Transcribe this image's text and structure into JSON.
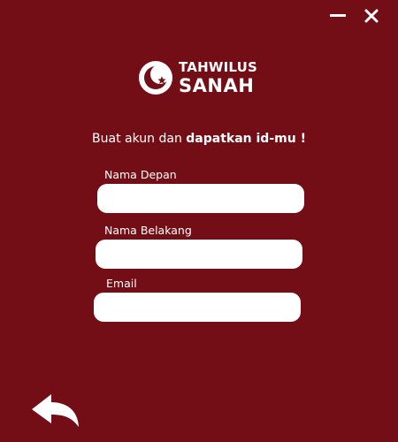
{
  "window": {
    "minimize_icon": "minimize-icon",
    "close_icon": "close-icon"
  },
  "logo": {
    "line1": "TAHWILUS",
    "line2": "SANAH",
    "icon": "crescent-star-icon"
  },
  "headline": {
    "normal": "Buat akun dan ",
    "bold": "dapatkan id-mu !"
  },
  "form": {
    "first_name": {
      "label": "Nama Depan",
      "value": ""
    },
    "last_name": {
      "label": "Nama Belakang",
      "value": ""
    },
    "email": {
      "label": "Email",
      "value": ""
    }
  },
  "back": {
    "icon": "back-arrow-icon"
  },
  "colors": {
    "background": "#740e16",
    "foreground": "#ffffff"
  }
}
